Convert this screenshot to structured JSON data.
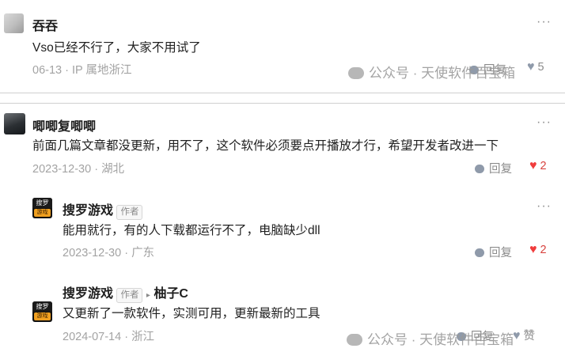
{
  "comment1": {
    "username": "吞吞",
    "text": "Vso已经不行了，大家不用试了",
    "date": "06-13",
    "location": "IP 属地浙江",
    "reply_label": "回复",
    "like_count": "5",
    "more": "···"
  },
  "comment2": {
    "username": "唧唧复唧唧",
    "text": "前面几篇文章都没更新，用不了，这个软件必须要点开播放才行，希望开发者改进一下",
    "date": "2023-12-30",
    "location": "湖北",
    "reply_label": "回复",
    "like_count": "2",
    "more": "···"
  },
  "reply1": {
    "username": "搜罗游戏",
    "author_tag": "作者",
    "avatar_text_top": "搜罗",
    "avatar_text_bottom": "游戏",
    "text": "能用就行，有的人下载都运行不了，电脑缺少dll",
    "date": "2023-12-30",
    "location": "广东",
    "reply_label": "回复",
    "like_count": "2",
    "more": "···"
  },
  "reply2": {
    "username": "搜罗游戏",
    "author_tag": "作者",
    "reply_to": "柚子C",
    "avatar_text_top": "搜罗",
    "avatar_text_bottom": "游戏",
    "text": "又更新了一款软件，实测可用，更新最新的工具",
    "date": "2024-07-14",
    "location": "浙江",
    "reply_label": "回复",
    "like_label": "赞",
    "more": "···"
  },
  "watermark": {
    "text": "公众号 · 天使软件百宝箱"
  },
  "colors": {
    "like_red": "#f03c3c",
    "meta_gray": "#a3a3a3",
    "icon_gray": "#8f9aaa"
  }
}
